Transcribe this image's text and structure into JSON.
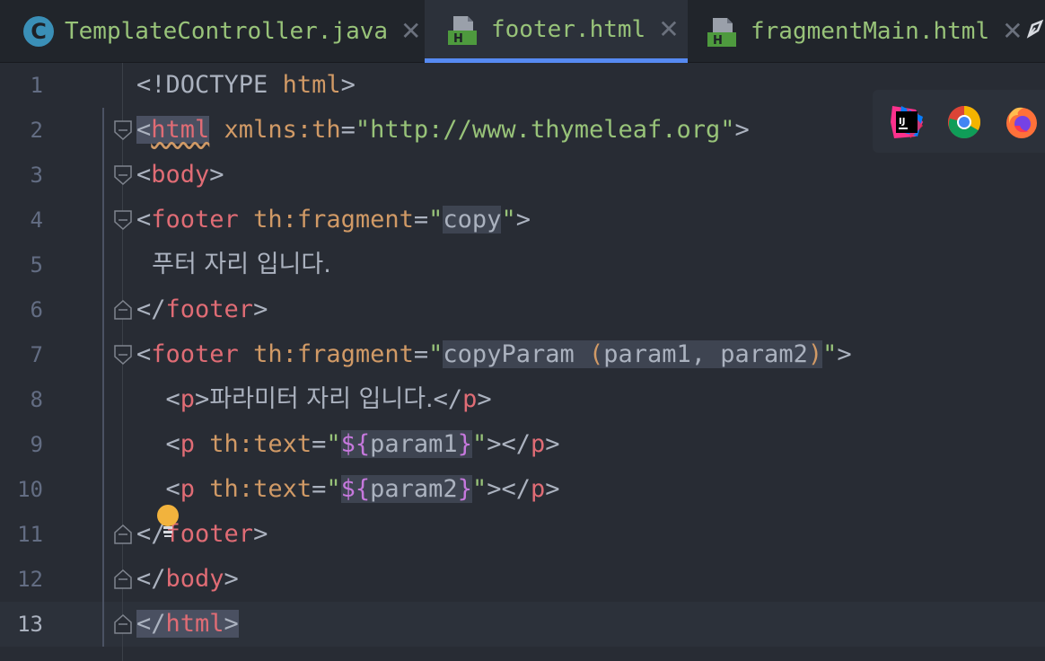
{
  "tabs": [
    {
      "label": "TemplateController.java",
      "icon": "java-class-icon",
      "color": "#98c379",
      "active": false
    },
    {
      "label": "footer.html",
      "icon": "html-file-icon",
      "color": "#98c379",
      "active": true
    },
    {
      "label": "fragmentMain.html",
      "icon": "html-file-icon",
      "color": "#98c379",
      "active": false
    }
  ],
  "tab_icon_letters": {
    "java": "C"
  },
  "close_glyph": "✕",
  "editor": {
    "line_numbers": [
      "1",
      "2",
      "3",
      "4",
      "5",
      "6",
      "7",
      "8",
      "9",
      "10",
      "11",
      "12",
      "13"
    ],
    "current_line": "13",
    "lines": [
      [
        {
          "t": "<!DOCTYPE ",
          "c": "doctype"
        },
        {
          "t": "html",
          "c": "attr"
        },
        {
          "t": ">",
          "c": "punc"
        }
      ],
      [
        {
          "t": "<",
          "c": "punc",
          "h": "tag"
        },
        {
          "t": "html",
          "c": "tag",
          "h": "tag",
          "sq": true
        },
        {
          "t": " xmlns:th",
          "c": "attr"
        },
        {
          "t": "=",
          "c": "punc"
        },
        {
          "t": "\"http://www.thymeleaf.org\"",
          "c": "str"
        },
        {
          "t": ">",
          "c": "punc"
        }
      ],
      [
        {
          "t": "<",
          "c": "punc"
        },
        {
          "t": "body",
          "c": "tag"
        },
        {
          "t": ">",
          "c": "punc"
        }
      ],
      [
        {
          "t": "<",
          "c": "punc"
        },
        {
          "t": "footer",
          "c": "tag"
        },
        {
          "t": " th:fragment",
          "c": "attr"
        },
        {
          "t": "=",
          "c": "punc"
        },
        {
          "t": "\"",
          "c": "str"
        },
        {
          "t": "copy",
          "c": "plain",
          "h": "val"
        },
        {
          "t": "\"",
          "c": "str"
        },
        {
          "t": ">",
          "c": "punc"
        }
      ],
      [
        {
          "t": "  푸터 자리 입니다.",
          "c": "text"
        }
      ],
      [
        {
          "t": "</",
          "c": "punc"
        },
        {
          "t": "footer",
          "c": "tag"
        },
        {
          "t": ">",
          "c": "punc"
        }
      ],
      [
        {
          "t": "<",
          "c": "punc"
        },
        {
          "t": "footer",
          "c": "tag"
        },
        {
          "t": " th:fragment",
          "c": "attr"
        },
        {
          "t": "=",
          "c": "punc"
        },
        {
          "t": "\"",
          "c": "str"
        },
        {
          "t": "copyParam ",
          "c": "plain",
          "h": "val"
        },
        {
          "t": "(",
          "c": "attr",
          "h": "val"
        },
        {
          "t": "param1, param2",
          "c": "plain",
          "h": "val"
        },
        {
          "t": ")",
          "c": "attr",
          "h": "val"
        },
        {
          "t": "\"",
          "c": "str"
        },
        {
          "t": ">",
          "c": "punc"
        }
      ],
      [
        {
          "t": "  <",
          "c": "punc"
        },
        {
          "t": "p",
          "c": "tag"
        },
        {
          "t": ">",
          "c": "punc"
        },
        {
          "t": "파라미터 자리 입니다.",
          "c": "text"
        },
        {
          "t": "</",
          "c": "punc"
        },
        {
          "t": "p",
          "c": "tag"
        },
        {
          "t": ">",
          "c": "punc"
        }
      ],
      [
        {
          "t": "  <",
          "c": "punc"
        },
        {
          "t": "p",
          "c": "tag"
        },
        {
          "t": " th:text",
          "c": "attr"
        },
        {
          "t": "=",
          "c": "punc"
        },
        {
          "t": "\"",
          "c": "str"
        },
        {
          "t": "${",
          "c": "expr",
          "h": "val"
        },
        {
          "t": "param1",
          "c": "plain",
          "h": "val"
        },
        {
          "t": "}",
          "c": "expr",
          "h": "val"
        },
        {
          "t": "\"",
          "c": "str"
        },
        {
          "t": "></",
          "c": "punc"
        },
        {
          "t": "p",
          "c": "tag"
        },
        {
          "t": ">",
          "c": "punc"
        }
      ],
      [
        {
          "t": "  <",
          "c": "punc"
        },
        {
          "t": "p",
          "c": "tag"
        },
        {
          "t": " th:text",
          "c": "attr"
        },
        {
          "t": "=",
          "c": "punc"
        },
        {
          "t": "\"",
          "c": "str"
        },
        {
          "t": "${",
          "c": "expr",
          "h": "val"
        },
        {
          "t": "param2",
          "c": "plain",
          "h": "val"
        },
        {
          "t": "}",
          "c": "expr",
          "h": "val"
        },
        {
          "t": "\"",
          "c": "str"
        },
        {
          "t": "></",
          "c": "punc"
        },
        {
          "t": "p",
          "c": "tag"
        },
        {
          "t": ">",
          "c": "punc"
        }
      ],
      [
        {
          "t": "</",
          "c": "punc"
        },
        {
          "t": "footer",
          "c": "tag"
        },
        {
          "t": ">",
          "c": "punc"
        }
      ],
      [
        {
          "t": "</",
          "c": "punc"
        },
        {
          "t": "body",
          "c": "tag"
        },
        {
          "t": ">",
          "c": "punc"
        }
      ],
      [
        {
          "t": "</",
          "c": "punc",
          "h": "tag"
        },
        {
          "t": "html",
          "c": "tag",
          "h": "tag"
        },
        {
          "t": ">",
          "c": "punc",
          "h": "tag"
        }
      ]
    ],
    "fold_markers": [
      "",
      "open",
      "open",
      "open",
      "",
      "close",
      "open",
      "",
      "",
      "",
      "close",
      "close",
      "close"
    ]
  },
  "browser_popup": {
    "icons": [
      "intellij-icon",
      "chrome-icon",
      "firefox-icon"
    ],
    "intellij_label": "IJ"
  },
  "colors": {
    "background": "#282c34",
    "tab_accent": "#568af2",
    "tag": "#e06c75",
    "attribute": "#d19a66",
    "string": "#98c379",
    "expression": "#c678dd"
  }
}
